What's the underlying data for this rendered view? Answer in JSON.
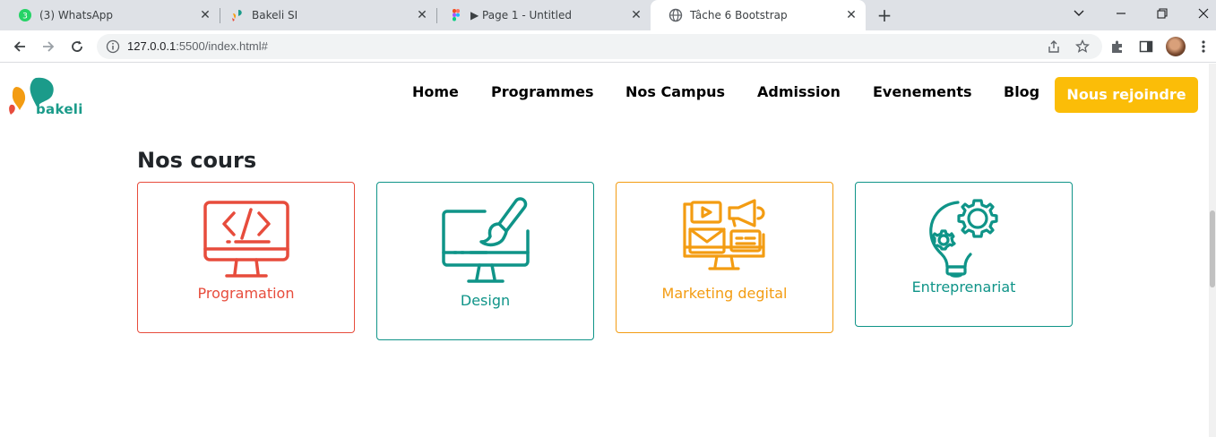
{
  "browser": {
    "tabs": [
      {
        "title": "(3) WhatsApp",
        "badge": "3"
      },
      {
        "title": "Bakeli SI"
      },
      {
        "title": "▶ Page 1 - Untitled"
      },
      {
        "title": "Tâche 6 Bootstrap"
      }
    ],
    "url_host": "127.0.0.1",
    "url_rest": ":5500/index.html#"
  },
  "site": {
    "logo_text": "bakeli",
    "nav": [
      "Home",
      "Programmes",
      "Nos Campus",
      "Admission",
      "Evenements",
      "Blog"
    ],
    "cta": "Nous rejoindre",
    "section_title": "Nos cours",
    "courses": [
      {
        "label": "Programation",
        "color": "#e74c3c"
      },
      {
        "label": "Design",
        "color": "#0f9488"
      },
      {
        "label": "Marketing degital",
        "color": "#f39c12"
      },
      {
        "label": "Entreprenariat",
        "color": "#0f9488"
      }
    ],
    "colors": {
      "accent_yellow": "#fbbd08",
      "brand_teal": "#1b9b8a"
    }
  }
}
